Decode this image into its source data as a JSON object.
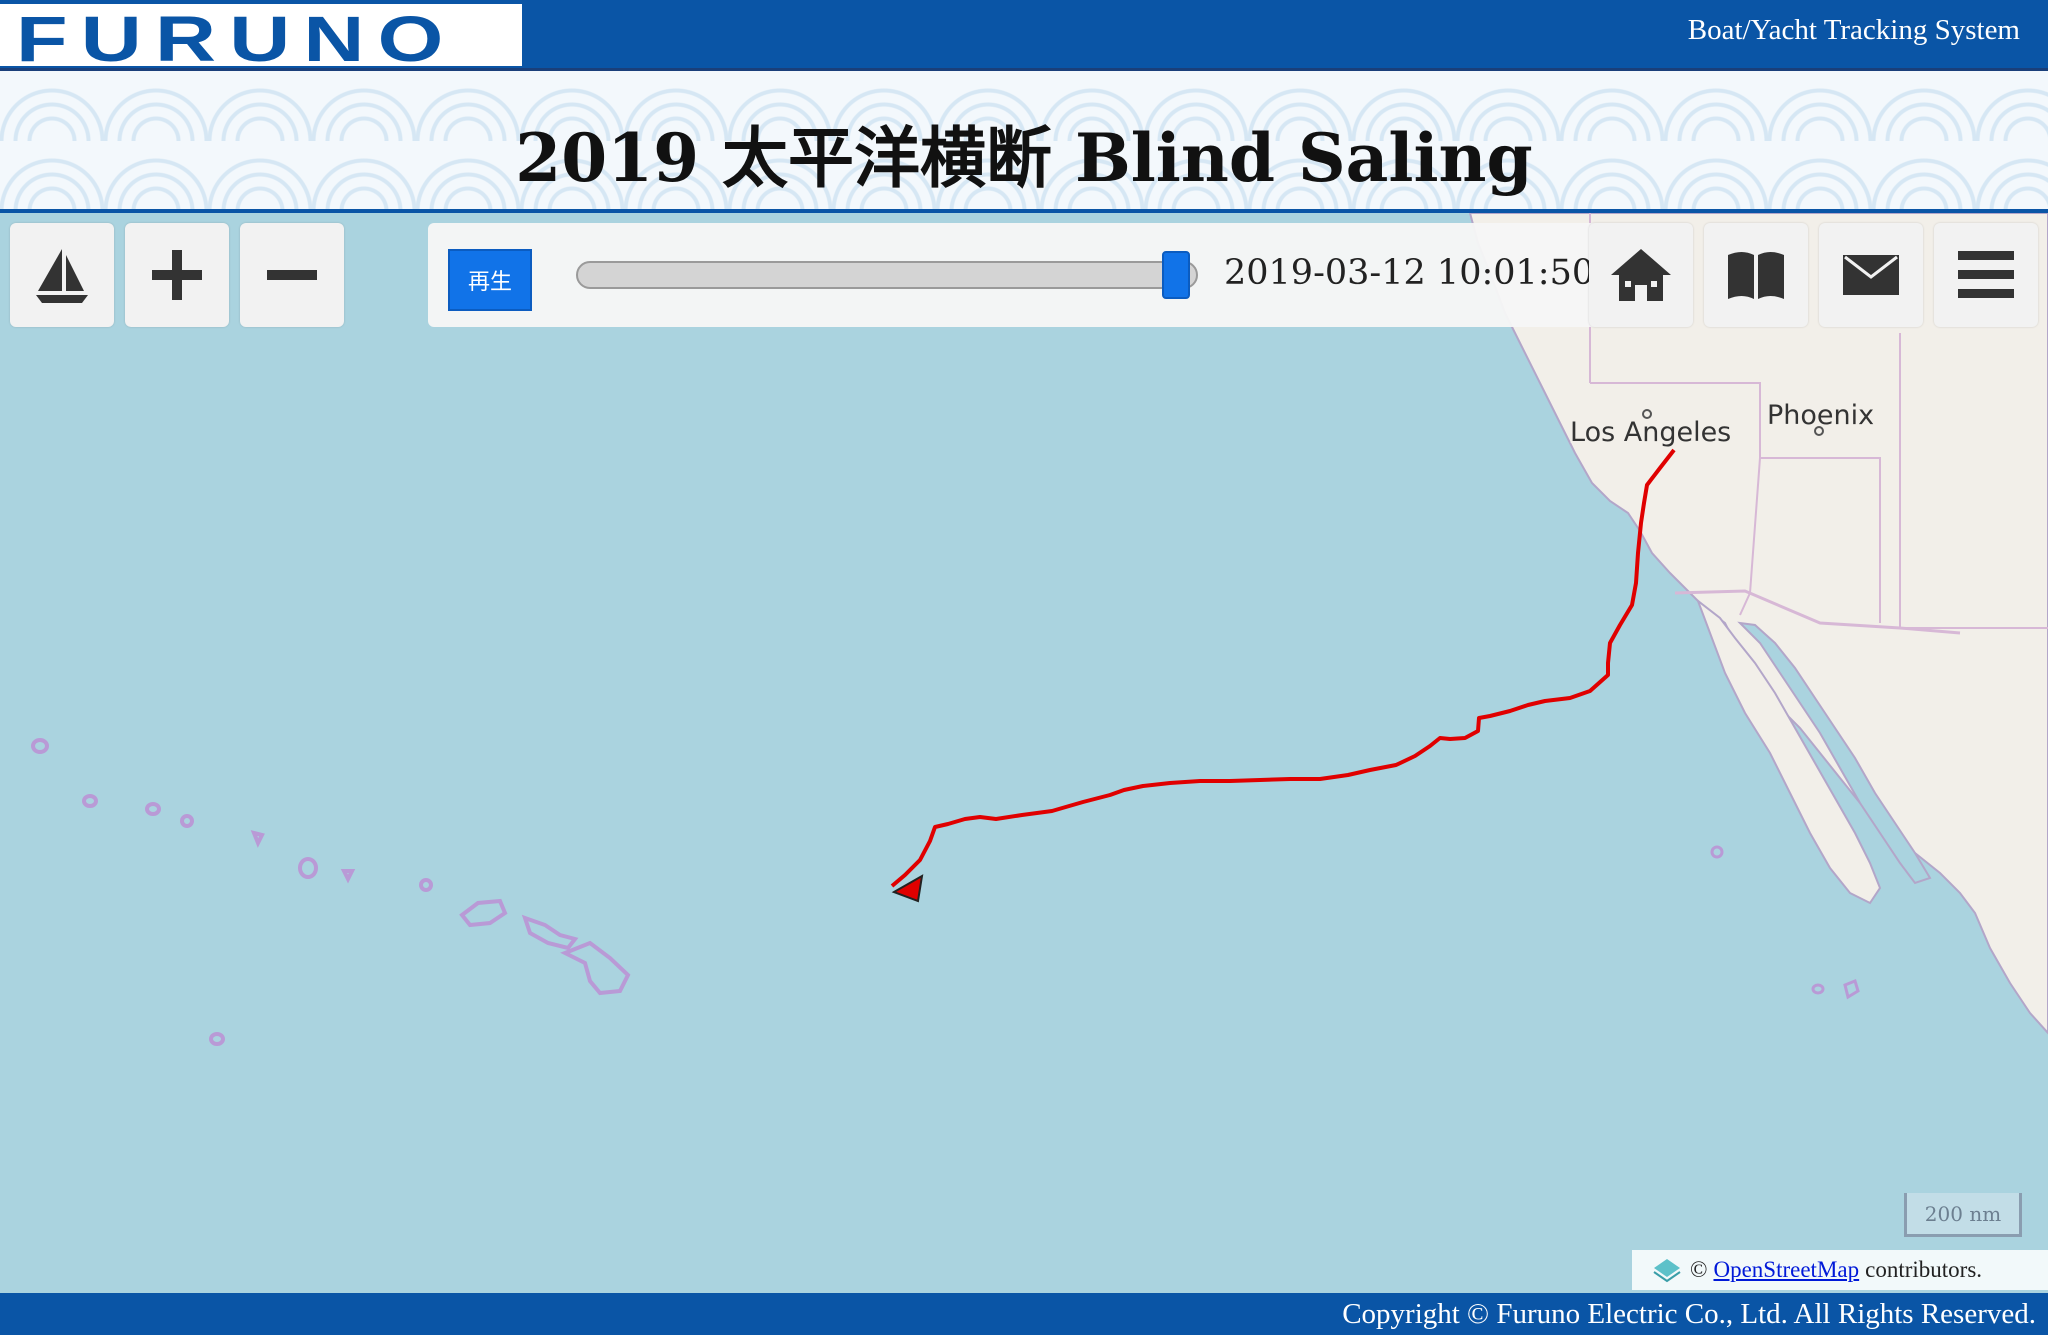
{
  "header": {
    "logo_text": "FURUNO",
    "system_name": "Boat/Yacht Tracking System"
  },
  "title": "2019 太平洋横断 Blind Saling",
  "controls": {
    "icons": [
      "sailboat-icon",
      "zoom-in-icon",
      "zoom-out-icon"
    ],
    "play_label": "再生",
    "timestamp": "2019-03-12 10:01:50",
    "slider_position": 0.99,
    "right_icons": [
      "home-icon",
      "book-icon",
      "mail-icon",
      "menu-icon"
    ]
  },
  "map": {
    "cities": [
      "Los Angeles",
      "Phoenix"
    ],
    "scale_label": "200 nm",
    "track_color": "#e00000",
    "water_color": "#aad3df",
    "land_color": "#f2efe9"
  },
  "attribution": {
    "prefix": "©",
    "link": "OpenStreetMap",
    "suffix": "contributors."
  },
  "footer": {
    "copyright": "Copyright © Furuno Electric Co., Ltd. All Rights Reserved."
  }
}
